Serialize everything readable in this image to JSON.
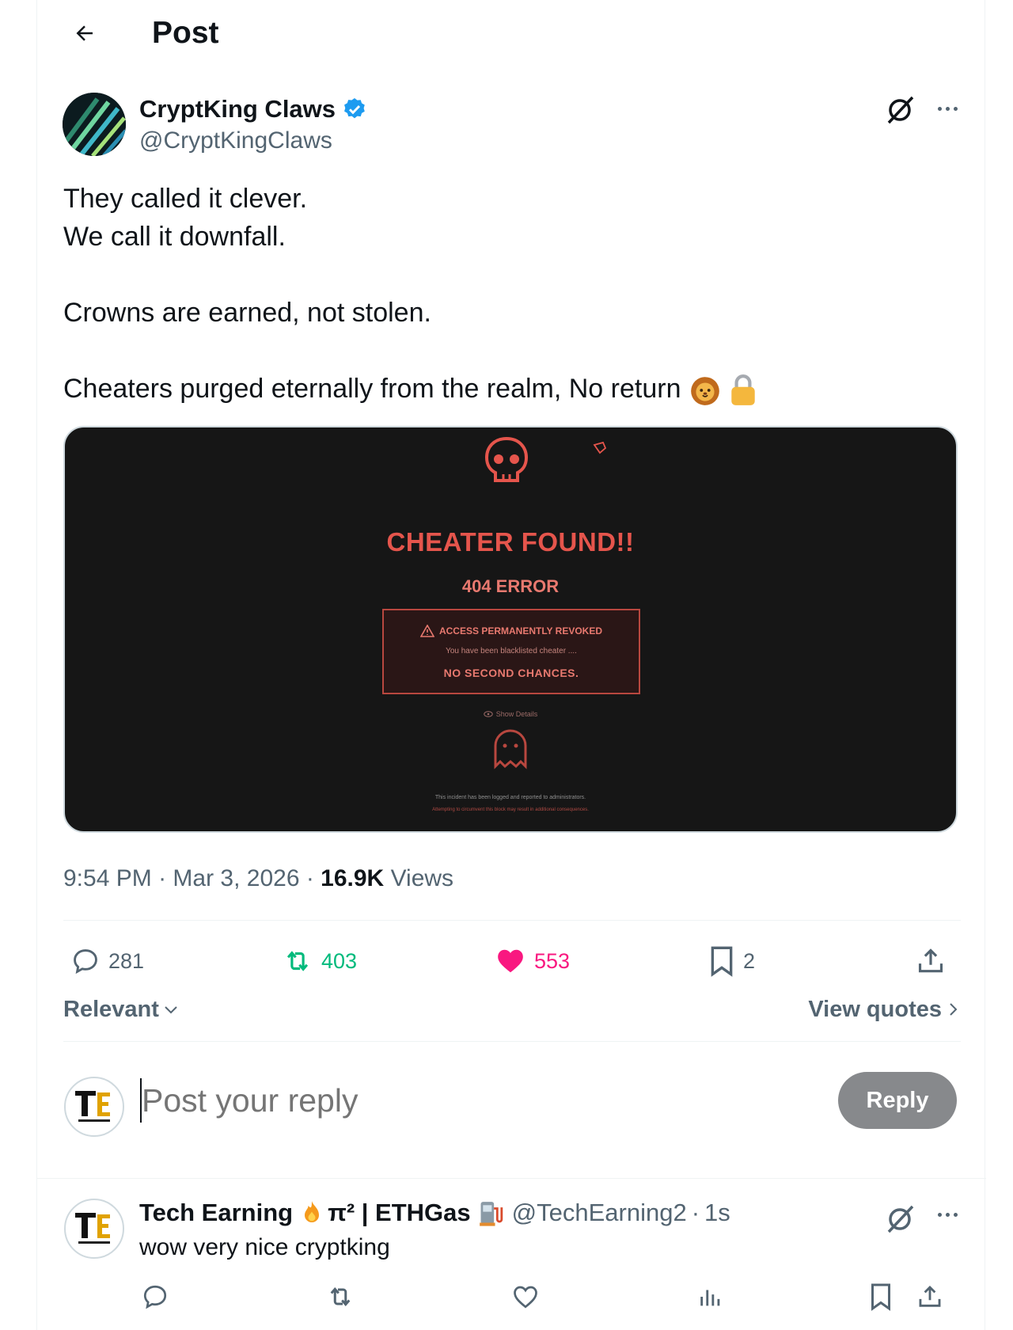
{
  "header": {
    "title": "Post"
  },
  "post": {
    "author_name": "CryptKing Claws",
    "author_handle": "@CryptKingClaws",
    "text_lines": [
      "They called it clever.",
      "We call it downfall.",
      "",
      "Crowns are earned, not stolen.",
      "",
      "Cheaters purged eternally from the realm, No return"
    ],
    "emojis": [
      "lion-face",
      "lock"
    ],
    "media": {
      "title": "CHEATER FOUND!!",
      "code": "404 ERROR",
      "box_title": "ACCESS PERMANENTLY REVOKED",
      "box_subtitle": "You have been blacklisted cheater ....",
      "box_final": "NO SECOND CHANCES.",
      "show_details": "Show Details",
      "footer_1": "This incident has been logged and reported to administrators.",
      "footer_2": "Attempting to circumvent this block may result in additional consequences."
    },
    "time": "9:54 PM",
    "date": "Mar 3, 2026",
    "views_count": "16.9K",
    "views_label": "Views",
    "stats": {
      "replies": "281",
      "reposts": "403",
      "likes": "553",
      "bookmarks": "2"
    }
  },
  "filters": {
    "sort": "Relevant",
    "view_quotes": "View quotes"
  },
  "composer": {
    "placeholder": "Post your reply",
    "button": "Reply"
  },
  "replies": [
    {
      "name": "Tech Earning",
      "name_suffix": "π² | ETHGas",
      "handle": "@TechEarning2",
      "time": "1s",
      "text": "wow very nice cryptking"
    }
  ],
  "colors": {
    "accent_blue": "#1d9bf0",
    "repost_green": "#00ba7c",
    "like_pink": "#f91880",
    "muted": "#536471",
    "media_red": "#e5554c"
  }
}
